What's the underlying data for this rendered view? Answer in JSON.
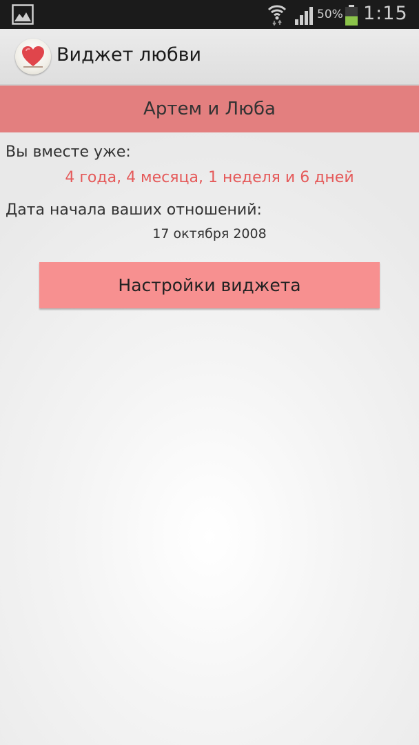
{
  "status_bar": {
    "battery_percent": "50%",
    "battery_level": 0.5,
    "time": "1:15",
    "icons": [
      "gallery-icon",
      "wifi-icon",
      "signal-icon",
      "battery-icon"
    ]
  },
  "action_bar": {
    "title": "Виджет любви",
    "icon": "heart-icon"
  },
  "banner": {
    "names": "Артем и Люба"
  },
  "together": {
    "label": "Вы вместе уже:",
    "value": "4 года, 4 месяца, 1 неделя и 6 дней"
  },
  "start": {
    "label": "Дата начала ваших отношений:",
    "date": "17 октября 2008"
  },
  "settings_button": {
    "label": "Настройки виджета"
  },
  "colors": {
    "banner": "#e37f7f",
    "accent_text": "#e55a5a",
    "button": "#f79090",
    "status_bar": "#1b1b1b",
    "battery_fill": "#8bc34a"
  }
}
